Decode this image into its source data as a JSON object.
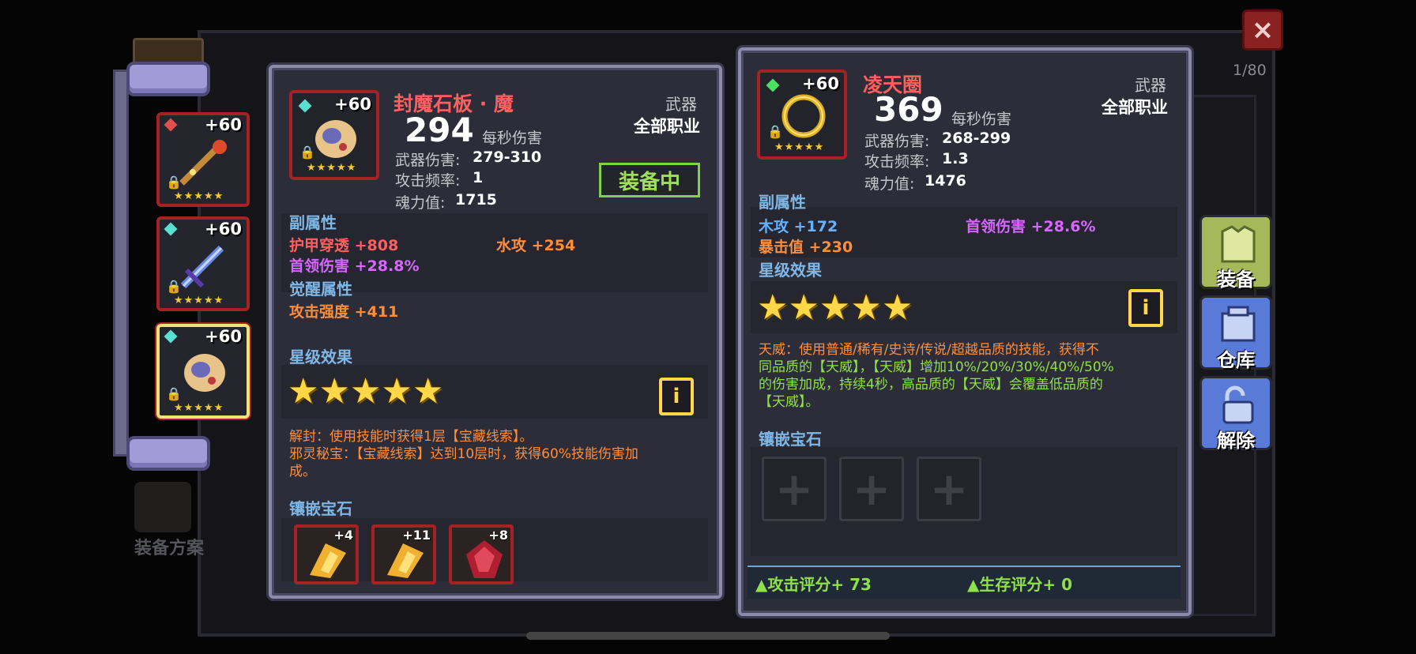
{
  "close_label": "×",
  "page_counter": "1/80",
  "sidebar": {
    "slots": [
      {
        "level": "+60",
        "gem_color": "#e0504a",
        "stars": "★★★★★",
        "icon": "fire-staff-icon"
      },
      {
        "level": "+60",
        "gem_color": "#58e0d0",
        "stars": "★★★★★",
        "icon": "crystal-sword-icon"
      },
      {
        "level": "+60",
        "gem_color": "#58e0d0",
        "stars": "★★★★★",
        "icon": "stone-tablet-icon"
      }
    ],
    "plan_label": "装备方案"
  },
  "current_item": {
    "name": "封魔石板 · 魔",
    "level": "+60",
    "dps": "294",
    "dps_label": "每秒伤害",
    "category": "武器",
    "class": "全部职业",
    "equipped_label": "装备中",
    "stats": [
      {
        "label": "武器伤害:",
        "value": "279-310"
      },
      {
        "label": "攻击频率:",
        "value": "1"
      },
      {
        "label": "魂力值:",
        "value": "1715"
      }
    ],
    "sub_attr_title": "副属性",
    "sub_attrs": [
      {
        "name": "护甲穿透",
        "value": "+808",
        "color": "#ff5f5f"
      },
      {
        "name": "水攻",
        "value": "+254",
        "color": "#ff8e3a"
      },
      {
        "name": "首领伤害",
        "value": "+28.8%",
        "color": "#d667ff"
      }
    ],
    "awaken_title": "觉醒属性",
    "awaken_attrs": [
      {
        "name": "攻击强度",
        "value": "+411",
        "color": "#ff8e3a"
      }
    ],
    "star_title": "星级效果",
    "star_count": 5,
    "star_effect_lines": [
      "解封：使用技能时获得1层【宝藏线索】。",
      "邪灵秘宝：【宝藏线索】达到10层时，获得60%技能伤害加",
      "成。"
    ],
    "gem_title": "镶嵌宝石",
    "gems": [
      {
        "level": "+4"
      },
      {
        "level": "+11"
      },
      {
        "level": "+8"
      }
    ]
  },
  "compare_item": {
    "name": "凌天圈",
    "level": "+60",
    "dps": "369",
    "dps_label": "每秒伤害",
    "category": "武器",
    "class": "全部职业",
    "stats": [
      {
        "label": "武器伤害:",
        "value": "268-299"
      },
      {
        "label": "攻击频率:",
        "value": "1.3"
      },
      {
        "label": "魂力值:",
        "value": "1476"
      }
    ],
    "sub_attr_title": "副属性",
    "sub_attrs": [
      {
        "name": "木攻",
        "value": "+172",
        "color": "#67b1ff"
      },
      {
        "name": "首领伤害",
        "value": "+28.6%",
        "color": "#d667ff"
      },
      {
        "name": "暴击值",
        "value": "+230",
        "color": "#ff8e3a"
      }
    ],
    "star_title": "星级效果",
    "star_count": 5,
    "star_effect_lines": [
      "天威：使用普通/稀有/史诗/传说/超越品质的技能，获得不",
      "同品质的【天威】，【天威】增加10%/20%/30%/40%/50%",
      "的伤害加成，持续4秒，高品质的【天威】会覆盖低品质的",
      "【天威】。"
    ],
    "gem_title": "镶嵌宝石",
    "empty_gem_symbol": "+",
    "score_attack": "▲攻击评分+ 73",
    "score_survive": "▲生存评分+ 0"
  },
  "actions": {
    "equip": "装备",
    "warehouse": "仓库",
    "release": "解除"
  }
}
